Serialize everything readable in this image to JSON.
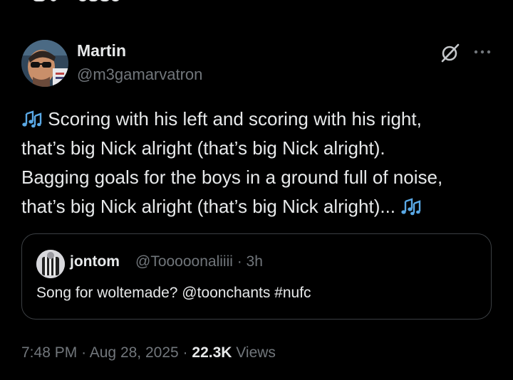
{
  "tweet": {
    "author": {
      "name": "Martin",
      "handle": "@m3gamarvatron"
    },
    "text_lines": [
      "Scoring with his left and scoring with his right,",
      "that’s big Nick alright (that’s big Nick alright).",
      "Bagging goals for the boys in a ground full of noise,",
      "that’s big Nick alright (that’s big Nick alright)..."
    ],
    "note_emoji_icon": "musical-notes-icon",
    "quote": {
      "author_name": "jontom",
      "handle_time": "@Tooooonaliiii · 3h",
      "text": "Song for woltemade? @toonchants #nufc"
    },
    "meta": {
      "time": "7:48 PM",
      "separator": "·",
      "date": "Aug 28, 2025",
      "views_count": "22.3K",
      "views_label": "Views"
    }
  },
  "colors": {
    "background": "#000000",
    "primary_text": "#e7e9ea",
    "secondary_text": "#71767b",
    "border": "#3b3f43",
    "note_blue": "#5aa9e6"
  }
}
